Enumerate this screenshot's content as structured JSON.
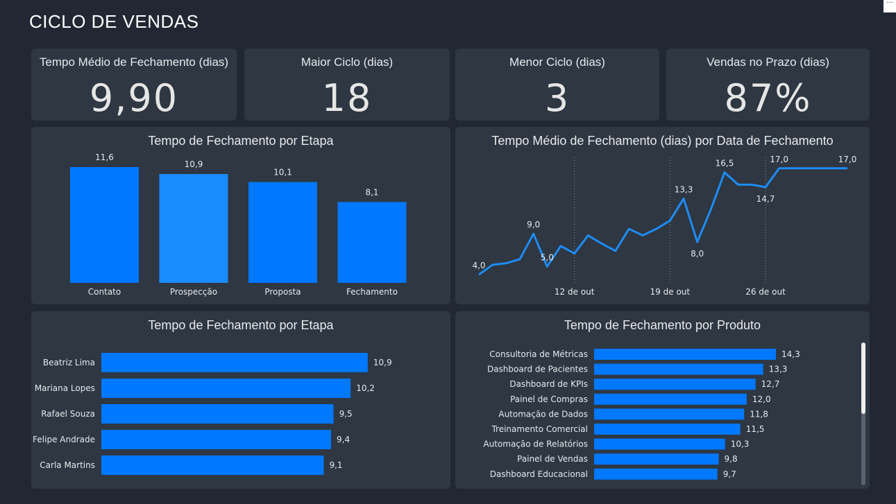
{
  "page": {
    "title": "CICLO DE VENDAS"
  },
  "kpis": [
    {
      "label": "Tempo Médio de Fechamento (dias)",
      "value": "9,90"
    },
    {
      "label": "Maior Ciclo (dias)",
      "value": "18"
    },
    {
      "label": "Menor Ciclo (dias)",
      "value": "3"
    },
    {
      "label": "Vendas no Prazo (dias)",
      "value": "87%"
    }
  ],
  "colors": {
    "bar": "#0078ff",
    "bar_alt": "#1a8cff",
    "line": "#1e8cf5",
    "card": "#2e3742",
    "background": "#222833"
  },
  "charts": {
    "stage": {
      "title": "Tempo de Fechamento por Etapa"
    },
    "date": {
      "title": "Tempo Médio de Fechamento (dias) por Data de Fechamento"
    },
    "seller": {
      "title": "Tempo de Fechamento por Etapa"
    },
    "product": {
      "title": "Tempo de Fechamento por Produto"
    }
  },
  "chart_data": [
    {
      "type": "bar",
      "title": "Tempo de Fechamento por Etapa",
      "categories": [
        "Contato",
        "Prospecção",
        "Proposta",
        "Fechamento"
      ],
      "values": [
        11.6,
        10.9,
        10.1,
        8.1
      ],
      "labels": [
        "11,6",
        "10,9",
        "10,1",
        "8,1"
      ],
      "ylim": [
        0,
        12
      ]
    },
    {
      "type": "line",
      "title": "Tempo Médio de Fechamento (dias) por Data de Fechamento",
      "x": [
        "2024-10-05",
        "2024-10-06",
        "2024-10-07",
        "2024-10-08",
        "2024-10-09",
        "2024-10-10",
        "2024-10-11",
        "2024-10-12",
        "2024-10-13",
        "2024-10-14",
        "2024-10-15",
        "2024-10-16",
        "2024-10-17",
        "2024-10-18",
        "2024-10-19",
        "2024-10-20",
        "2024-10-21",
        "2024-10-22",
        "2024-10-23",
        "2024-10-24",
        "2024-10-25",
        "2024-10-26",
        "2024-10-27",
        "2024-10-28",
        "2024-10-29",
        "2024-10-30",
        "2024-10-31",
        "2024-11-01"
      ],
      "values": [
        4.0,
        5.2,
        5.4,
        5.9,
        9.0,
        5.0,
        7.5,
        6.6,
        8.8,
        7.8,
        6.9,
        9.6,
        8.8,
        9.6,
        10.6,
        13.3,
        8.0,
        12.0,
        16.5,
        15.0,
        15.0,
        14.7,
        17.0,
        17.0,
        17.0,
        17.0,
        17.0,
        17.0
      ],
      "point_labels": [
        {
          "index": 0,
          "text": "4,0"
        },
        {
          "index": 4,
          "text": "9,0"
        },
        {
          "index": 5,
          "text": "5,0"
        },
        {
          "index": 15,
          "text": "13,3"
        },
        {
          "index": 16,
          "text": "8,0"
        },
        {
          "index": 18,
          "text": "16,5"
        },
        {
          "index": 21,
          "text": "14,7"
        },
        {
          "index": 22,
          "text": "17,0"
        },
        {
          "index": 27,
          "text": "17,0"
        }
      ],
      "x_ticks": [
        {
          "date": "2024-10-12",
          "label": "12 de out"
        },
        {
          "date": "2024-10-19",
          "label": "19 de out"
        },
        {
          "date": "2024-10-26",
          "label": "26 de out"
        }
      ],
      "ylim": [
        3,
        18
      ]
    },
    {
      "type": "bar",
      "orientation": "horizontal",
      "title": "Tempo de Fechamento por Etapa",
      "categories": [
        "Beatriz Lima",
        "Mariana Lopes",
        "Rafael Souza",
        "Felipe Andrade",
        "Carla Martins"
      ],
      "values": [
        10.9,
        10.2,
        9.5,
        9.4,
        9.1
      ],
      "labels": [
        "10,9",
        "10,2",
        "9,5",
        "9,4",
        "9,1"
      ],
      "xlim": [
        0,
        11.5
      ]
    },
    {
      "type": "bar",
      "orientation": "horizontal",
      "title": "Tempo de Fechamento por Produto",
      "categories": [
        "Consultoria de Métricas",
        "Dashboard de Pacientes",
        "Dashboard de KPIs",
        "Painel de Compras",
        "Automação de Dados",
        "Treinamento Comercial",
        "Automação de Relatórios",
        "Painel de Vendas",
        "Dashboard Educacional"
      ],
      "values": [
        14.3,
        13.3,
        12.7,
        12.0,
        11.8,
        11.5,
        10.3,
        9.8,
        9.7
      ],
      "labels": [
        "14,3",
        "13,3",
        "12,7",
        "12,0",
        "11,8",
        "11,5",
        "10,3",
        "9,8",
        "9,7"
      ],
      "xlim": [
        0,
        14.3
      ],
      "scroll_fraction": 0.5
    }
  ]
}
